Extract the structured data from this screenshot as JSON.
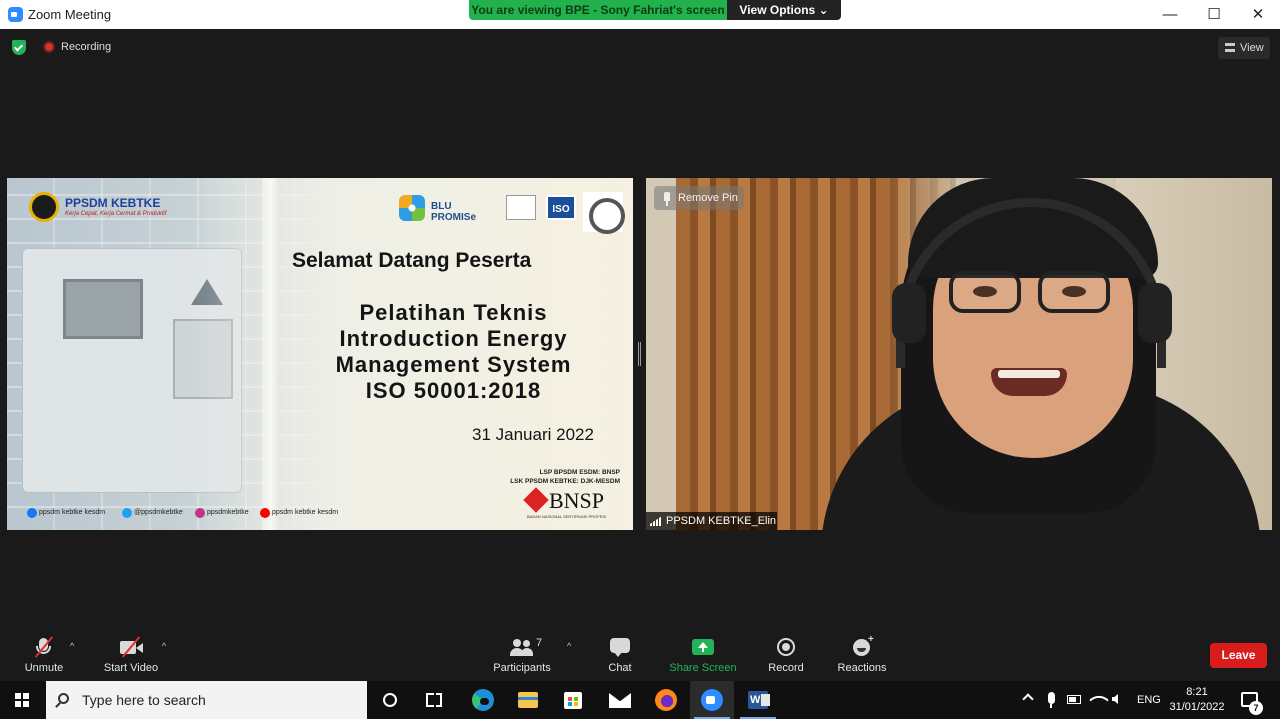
{
  "window": {
    "title": "Zoom Meeting",
    "minimize_glyph": "—",
    "maximize_glyph": "☐",
    "close_glyph": "✕"
  },
  "share_banner": {
    "message": "You are viewing BPE - Sony Fahriat's screen",
    "view_options": "View Options ⌄"
  },
  "top_bar": {
    "recording_label": "Recording",
    "view_label": "View"
  },
  "shared_slide": {
    "org_name": "PPSDM KEBTKE",
    "org_tagline": "Kerja Cepat, Kerja Cermat & Produktif",
    "partner_logo_text": "BLU PROMISe",
    "iso_badge": "ISO",
    "welcome": "Selamat Datang Peserta",
    "course_lines": [
      "Pelatihan Teknis",
      "Introduction Energy",
      "Management System",
      "ISO 50001:2018"
    ],
    "date": "31 Januari 2022",
    "lsp_lines": [
      "LSP BPSDM ESDM: BNSP",
      "LSK PPSDM KEBTKE: DJK-MESDM"
    ],
    "bnsp_text": "BNSP",
    "bnsp_sub": "BADAN NASIONAL SERTIFIKASI PROFESI",
    "socials": [
      {
        "label": "ppsdm kebtke kesdm",
        "color": "#1877f2"
      },
      {
        "label": "@ppsdmkebtke",
        "color": "#1da1f2"
      },
      {
        "label": "ppsdmkebtke",
        "color": "#c13584"
      },
      {
        "label": "ppsdm kebtke kesdm",
        "color": "#ff0000"
      }
    ]
  },
  "video_tile": {
    "remove_pin": "Remove Pin",
    "participant_name": "PPSDM KEBTKE_Elin"
  },
  "toolbar": {
    "unmute": "Unmute",
    "start_video": "Start Video",
    "participants": "Participants",
    "participants_count": "7",
    "chat": "Chat",
    "share_screen": "Share Screen",
    "record": "Record",
    "reactions": "Reactions",
    "leave": "Leave",
    "caret": "^"
  },
  "taskbar": {
    "search_placeholder": "Type here to search",
    "word_letter": "W",
    "language": "ENG",
    "time": "8:21",
    "date": "31/01/2022",
    "notification_count": "7"
  }
}
